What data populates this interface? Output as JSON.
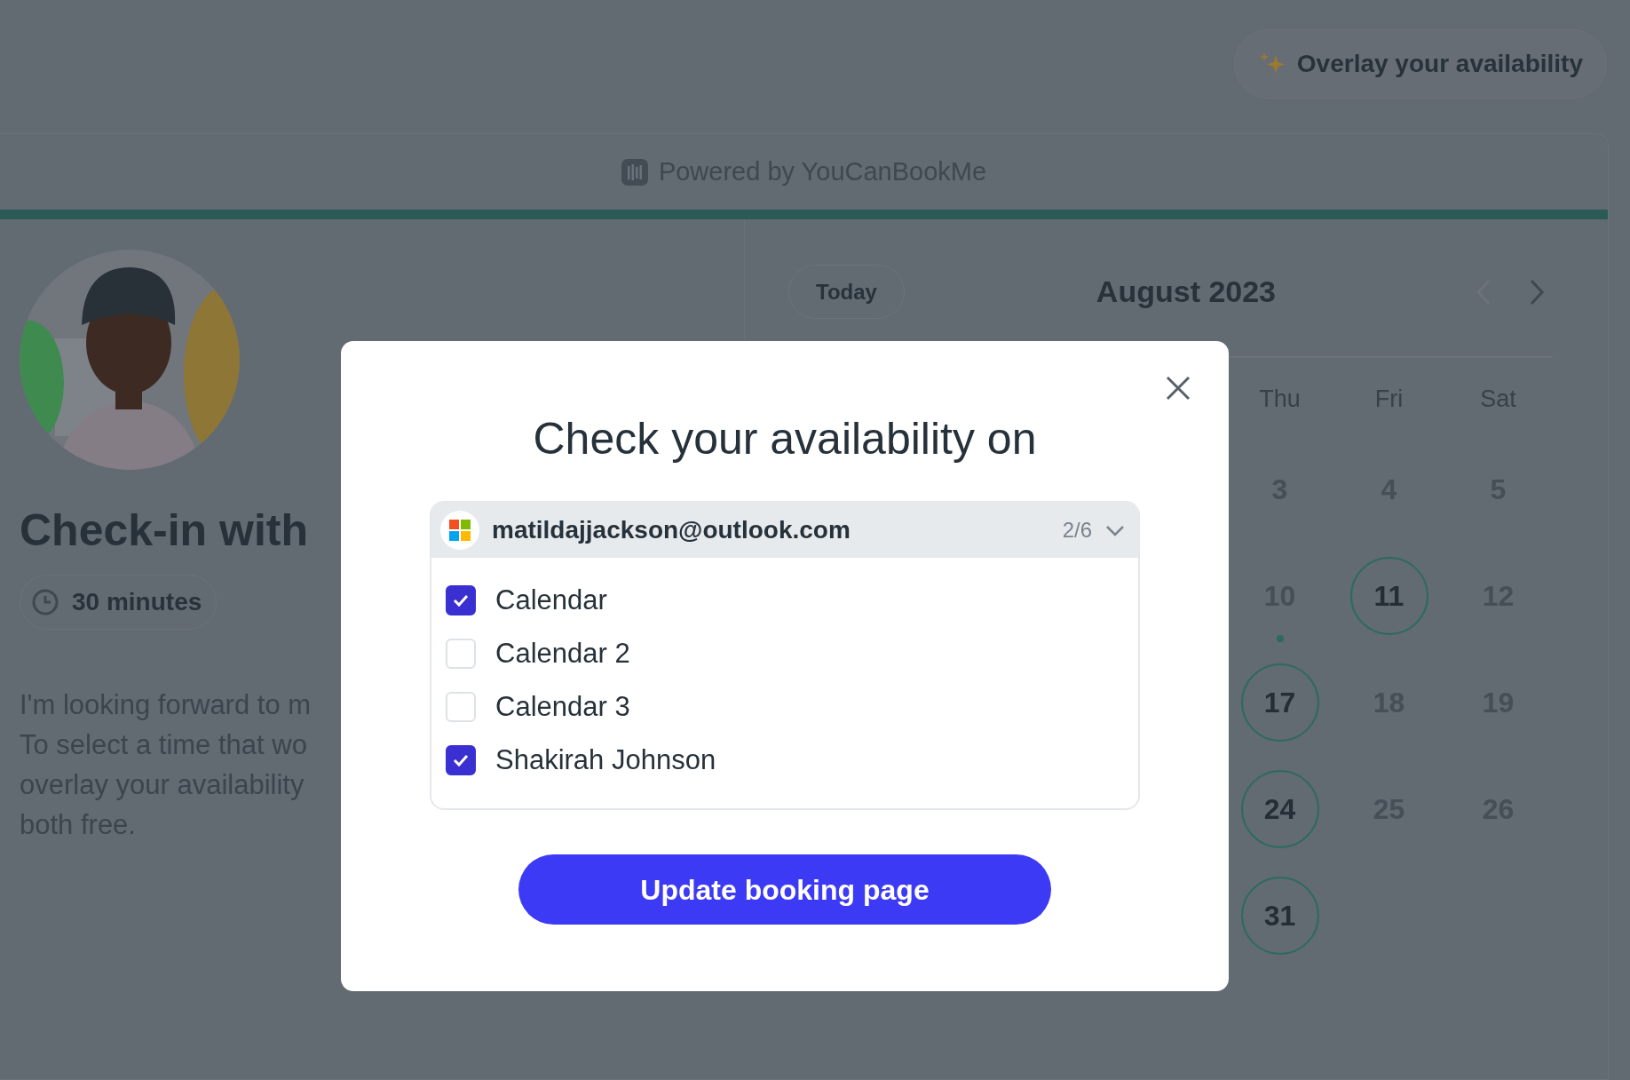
{
  "overlay_button": {
    "label": "Overlay your availability"
  },
  "powered_by": "Powered by YouCanBookMe",
  "profile": {
    "avatar": {
      "kind": "picture"
    },
    "title": "Check-in with",
    "duration": "30 minutes",
    "description": [
      "I'm looking forward to m",
      "To select a time that wo",
      "overlay your availability",
      "both free."
    ]
  },
  "calendar": {
    "today_button": "Today",
    "month": "August 2023",
    "prev_disabled": true,
    "next_disabled": false,
    "weekdays": [
      "Thu",
      "Fri",
      "Sat"
    ],
    "weeks": [
      [
        {
          "day": "3",
          "available": false,
          "has_event": false
        },
        {
          "day": "4",
          "available": false,
          "has_event": false
        },
        {
          "day": "5",
          "available": false,
          "has_event": false
        }
      ],
      [
        {
          "day": "10",
          "available": false,
          "has_event": true
        },
        {
          "day": "11",
          "available": true,
          "has_event": false
        },
        {
          "day": "12",
          "available": false,
          "has_event": false
        }
      ],
      [
        {
          "day": "17",
          "available": true,
          "has_event": false
        },
        {
          "day": "18",
          "available": false,
          "has_event": false
        },
        {
          "day": "19",
          "available": false,
          "has_event": false
        }
      ],
      [
        {
          "day": "24",
          "available": true,
          "has_event": false
        },
        {
          "day": "25",
          "available": false,
          "has_event": false
        },
        {
          "day": "26",
          "available": false,
          "has_event": false
        }
      ],
      [
        {
          "day": "31",
          "available": true,
          "has_event": false
        }
      ]
    ]
  },
  "modal": {
    "title": "Check your availability on",
    "account": {
      "email": "matildajjackson@outlook.com",
      "count": "2/6",
      "expanded": true
    },
    "calendars": [
      {
        "name": "Calendar",
        "checked": true
      },
      {
        "name": "Calendar 2",
        "checked": false
      },
      {
        "name": "Calendar 3",
        "checked": false
      },
      {
        "name": "Shakirah Johnson",
        "checked": true
      }
    ],
    "submit_button": "Update booking page"
  }
}
